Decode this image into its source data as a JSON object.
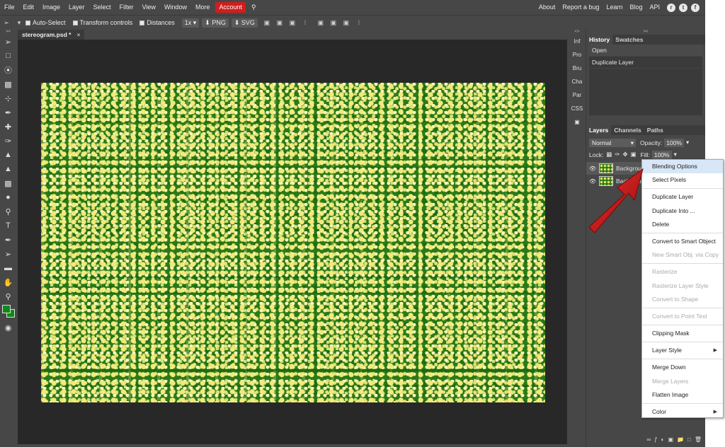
{
  "menubar": {
    "items": [
      "File",
      "Edit",
      "Image",
      "Layer",
      "Select",
      "Filter",
      "View",
      "Window",
      "More",
      "Account"
    ],
    "right_links": [
      "About",
      "Report a bug",
      "Learn",
      "Blog",
      "API"
    ]
  },
  "options": {
    "auto_select": "Auto-Select",
    "transform_controls": "Transform controls",
    "distances": "Distances",
    "zoom": "1x",
    "png": "PNG",
    "svg": "SVG"
  },
  "document": {
    "tab_title": "stereogram.psd *",
    "close": "×"
  },
  "side_strip": [
    "Inf",
    "Pro",
    "Bru",
    "Cha",
    "Par",
    "CSS"
  ],
  "history_panel": {
    "tabs": [
      "History",
      "Swatches"
    ],
    "items": [
      "Open",
      "Duplicate Layer"
    ]
  },
  "layers_panel": {
    "tabs": [
      "Layers",
      "Channels",
      "Paths"
    ],
    "blend_mode": "Normal",
    "opacity_label": "Opacity:",
    "opacity_value": "100%",
    "lock_label": "Lock:",
    "fill_label": "Fill:",
    "fill_value": "100%",
    "layers": [
      "Background copy",
      "Background"
    ]
  },
  "context_menu": {
    "items": [
      {
        "label": "Blending Options",
        "state": "hover"
      },
      {
        "label": "Select Pixels",
        "state": "enabled"
      },
      {
        "label": "Duplicate Layer",
        "state": "enabled"
      },
      {
        "label": "Duplicate Into ...",
        "state": "enabled"
      },
      {
        "label": "Delete",
        "state": "enabled"
      },
      {
        "label": "Convert to Smart Object",
        "state": "enabled"
      },
      {
        "label": "New Smart Obj. via Copy",
        "state": "disabled"
      },
      {
        "label": "Rasterize",
        "state": "disabled"
      },
      {
        "label": "Rasterize Layer Style",
        "state": "disabled"
      },
      {
        "label": "Convert to Shape",
        "state": "disabled"
      },
      {
        "label": "Convert to Point Text",
        "state": "disabled"
      },
      {
        "label": "Clipping Mask",
        "state": "enabled"
      },
      {
        "label": "Layer Style",
        "state": "submenu"
      },
      {
        "label": "Merge Down",
        "state": "enabled"
      },
      {
        "label": "Merge Layers",
        "state": "disabled"
      },
      {
        "label": "Flatten Image",
        "state": "enabled"
      },
      {
        "label": "Color",
        "state": "submenu"
      }
    ]
  },
  "colors": {
    "accent_account": "#d01e1e",
    "foreground_color": "#0d8a18",
    "background_color": "#0d8a18",
    "arrow": "#c81414"
  }
}
